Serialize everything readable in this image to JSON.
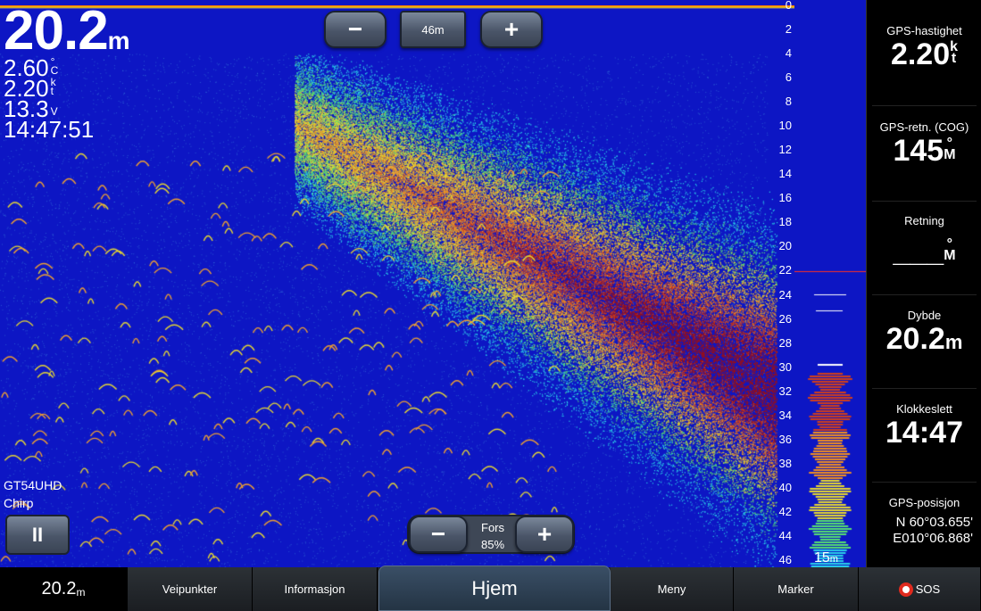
{
  "sonar": {
    "depth_value": "20.2",
    "depth_unit": "m",
    "water_temp": "2.60",
    "water_temp_unit_top": "°",
    "water_temp_unit_bottom": "C",
    "speed": "2.20",
    "speed_unit_top": "k",
    "speed_unit_bottom": "t",
    "voltage": "13.3",
    "voltage_unit": "V",
    "time": "14:47:51",
    "transducer": "GT54UHD",
    "mode": "Chirp",
    "depth_scale": [
      "0",
      "2",
      "4",
      "6",
      "8",
      "10",
      "12",
      "14",
      "16",
      "18",
      "20",
      "22",
      "24",
      "26",
      "28",
      "30",
      "32",
      "34",
      "36",
      "38",
      "40",
      "42",
      "44",
      "46"
    ],
    "flasher_range_value": "15",
    "flasher_range_unit": "m"
  },
  "range_control": {
    "minus_label": "−",
    "value": "46m",
    "plus_label": "+"
  },
  "gain_control": {
    "minus_label": "−",
    "label": "Fors",
    "value": "85%",
    "plus_label": "+"
  },
  "pause_button": {
    "label": "II"
  },
  "data_fields": [
    {
      "label": "GPS-hastighet",
      "value": "2.20",
      "unit_top": "k",
      "unit_bottom": "t"
    },
    {
      "label": "GPS-retn. (COG)",
      "value": "145",
      "unit_top": "°",
      "unit_bottom": "M"
    },
    {
      "label": "Retning",
      "value": "___",
      "unit_top": "°",
      "unit_bottom": "M"
    },
    {
      "label": "Dybde",
      "value": "20.2",
      "unit": "m"
    },
    {
      "label": "Klokkeslett",
      "value": "14:47"
    },
    {
      "label": "GPS-posisjon",
      "lat": "N  60°03.655'",
      "lon": "E010°06.868'"
    }
  ],
  "bottom_bar": {
    "depth_value": "20.2",
    "depth_unit": "m",
    "waypoints": "Veipunkter",
    "information": "Informasjon",
    "home": "Hjem",
    "menu": "Meny",
    "marker": "Marker",
    "sos": "SOS"
  },
  "colors": {
    "sonar_background": "#0d16c4",
    "strong_return": "#d2401a",
    "medium_return": "#e8d830",
    "weak_return": "#40c0d8",
    "sos_red": "#e02a1e"
  }
}
